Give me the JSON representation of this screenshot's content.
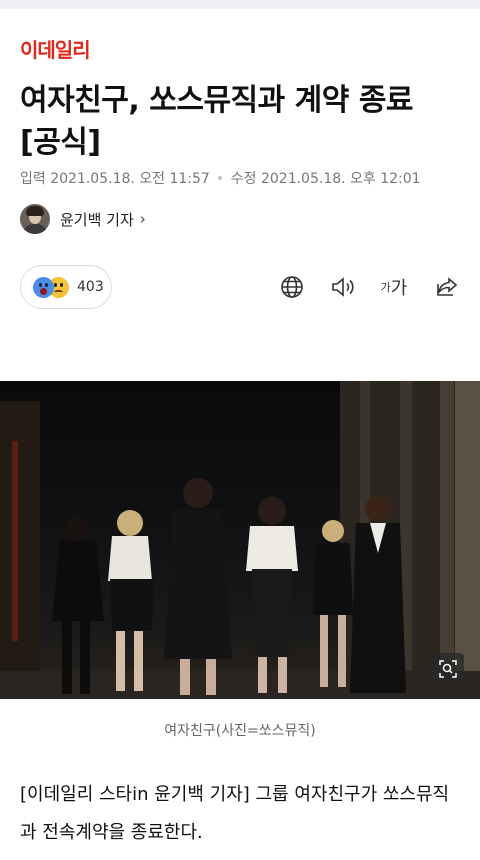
{
  "brand": {
    "logo_text": "이데일리",
    "accent_color": "#e1261c"
  },
  "article": {
    "title": "여자친구, 쏘스뮤직과 계약 종료 [공식]",
    "published_label": "입력",
    "published_time": "2021.05.18. 오전 11:57",
    "modified_label": "수정",
    "modified_time": "2021.05.18. 오후 12:01",
    "author": "윤기백 기자",
    "author_chevron": "›",
    "reaction_count": "403",
    "image_caption": "여자친구(사진=쏘스뮤직)",
    "body": "[이데일리 스타in 윤기백 기자] 그룹 여자친구가 쏘스뮤직과 전속계약을 종료한다."
  },
  "toolbar": {
    "font_small": "가",
    "font_large": "가",
    "icons": [
      "globe-icon",
      "speaker-icon",
      "font-size-icon",
      "share-icon"
    ]
  },
  "reactions": {
    "icons": [
      "surprised-face-icon",
      "sad-face-icon"
    ]
  }
}
